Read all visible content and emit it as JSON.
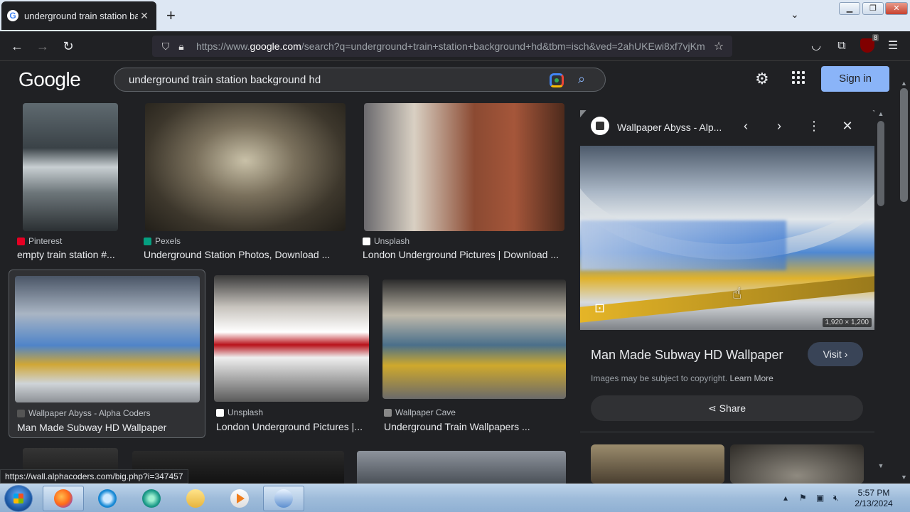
{
  "browser": {
    "tab_title": "underground train station back",
    "tab_favicon": "G",
    "new_tab_label": "+",
    "url_full": "https://www.google.com/search?q=underground+train+station+background+hd&tbm=isch&ved=2ahUKEwi8xf7vjKm",
    "url_prefix": "https://www.",
    "url_domain": "google.com",
    "url_rest": "/search?q=underground+train+station+background+hd&tbm=isch&ved=2ahUKEwi8xf7vjKm",
    "extension_badge": "8",
    "status_url": "https://wall.alphacoders.com/big.php?i=347457"
  },
  "google": {
    "logo": "Google",
    "query": "underground train station background hd",
    "signin_label": "Sign in"
  },
  "results": [
    {
      "source": "Pinterest",
      "title": "empty train station #...",
      "source_color": "#e60023"
    },
    {
      "source": "Pexels",
      "title": "Underground Station Photos, Download ...",
      "source_color": "#05a081"
    },
    {
      "source": "Unsplash",
      "title": "London Underground Pictures | Download ...",
      "source_color": "#ffffff"
    },
    {
      "source": "Wallpaper Abyss - Alpha Coders",
      "title": "Man Made Subway HD Wallpaper",
      "source_color": "#444444"
    },
    {
      "source": "Unsplash",
      "title": "London Underground Pictures |...",
      "source_color": "#ffffff"
    },
    {
      "source": "Wallpaper Cave",
      "title": "Underground Train Wallpapers ...",
      "source_color": "#888888"
    }
  ],
  "panel": {
    "site": "Wallpaper Abyss - Alp...",
    "dimensions": "1,920 × 1,200",
    "title": "Man Made Subway HD Wallpaper",
    "visit_label": "Visit",
    "copyright_text": "Images may be subject to copyright.",
    "learn_more": "Learn More",
    "share_label": "Share"
  },
  "taskbar": {
    "time": "5:57 PM",
    "date": "2/13/2024"
  },
  "colors": {
    "accent": "#8ab4f8",
    "page_bg": "#202124"
  }
}
